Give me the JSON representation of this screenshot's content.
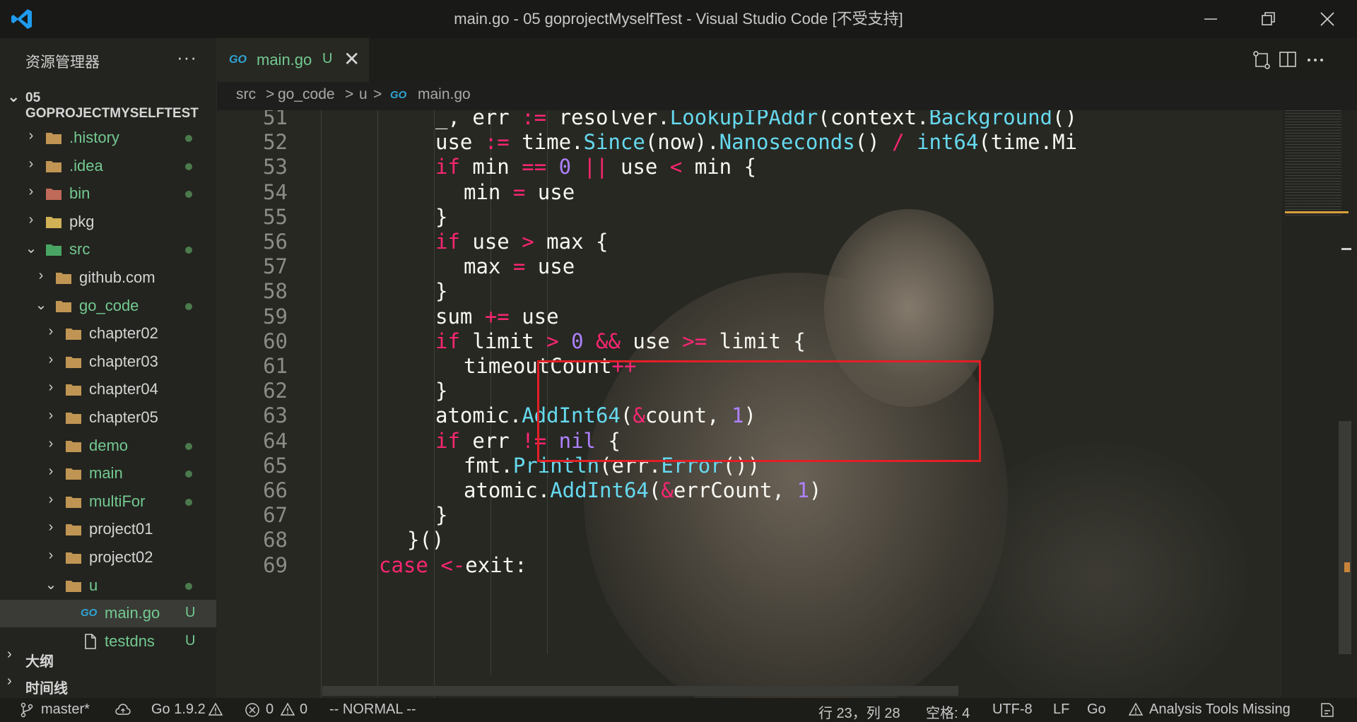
{
  "window": {
    "title": "main.go - 05 goprojectMyselfTest - Visual Studio Code [不受支持]"
  },
  "explorer": {
    "header": "资源管理器",
    "more": "···",
    "project": "05 GOPROJECTMYSELFTEST",
    "items": [
      {
        "name": ".history",
        "depth": 0,
        "expanded": false,
        "status": "dot",
        "color": "green",
        "icon": "folder-icon"
      },
      {
        "name": ".idea",
        "depth": 0,
        "expanded": false,
        "status": "dot",
        "color": "green",
        "icon": "idea-folder-icon"
      },
      {
        "name": "bin",
        "depth": 0,
        "expanded": false,
        "status": "dot",
        "color": "green",
        "icon": "bin-folder-icon"
      },
      {
        "name": "pkg",
        "depth": 0,
        "expanded": false,
        "status": "",
        "color": "plain",
        "icon": "pkg-folder-icon"
      },
      {
        "name": "src",
        "depth": 0,
        "expanded": true,
        "status": "dot",
        "color": "green",
        "icon": "src-folder-icon"
      },
      {
        "name": "github.com",
        "depth": 1,
        "expanded": false,
        "status": "",
        "color": "plain",
        "icon": "folder-icon"
      },
      {
        "name": "go_code",
        "depth": 1,
        "expanded": true,
        "status": "dot",
        "color": "green",
        "icon": "folder-icon"
      },
      {
        "name": "chapter02",
        "depth": 2,
        "expanded": false,
        "status": "",
        "color": "plain",
        "icon": "folder-icon"
      },
      {
        "name": "chapter03",
        "depth": 2,
        "expanded": false,
        "status": "",
        "color": "plain",
        "icon": "folder-icon"
      },
      {
        "name": "chapter04",
        "depth": 2,
        "expanded": false,
        "status": "",
        "color": "plain",
        "icon": "folder-icon"
      },
      {
        "name": "chapter05",
        "depth": 2,
        "expanded": false,
        "status": "",
        "color": "plain",
        "icon": "folder-icon"
      },
      {
        "name": "demo",
        "depth": 2,
        "expanded": false,
        "status": "dot",
        "color": "green",
        "icon": "folder-icon"
      },
      {
        "name": "main",
        "depth": 2,
        "expanded": false,
        "status": "dot",
        "color": "green",
        "icon": "folder-icon"
      },
      {
        "name": "multiFor",
        "depth": 2,
        "expanded": false,
        "status": "dot",
        "color": "green",
        "icon": "folder-icon"
      },
      {
        "name": "project01",
        "depth": 2,
        "expanded": false,
        "status": "",
        "color": "plain",
        "icon": "folder-icon"
      },
      {
        "name": "project02",
        "depth": 2,
        "expanded": false,
        "status": "",
        "color": "plain",
        "icon": "folder-icon"
      },
      {
        "name": "u",
        "depth": 2,
        "expanded": true,
        "status": "dot",
        "color": "green",
        "icon": "folder-icon"
      },
      {
        "name": "main.go",
        "depth": 3,
        "file": true,
        "status": "U",
        "color": "green",
        "icon": "go-file-icon",
        "selected": true
      },
      {
        "name": "testdns",
        "depth": 3,
        "file": true,
        "status": "U",
        "color": "green",
        "icon": "file-icon"
      }
    ],
    "outline": "大纲",
    "timeline": "时间线"
  },
  "tab": {
    "go_label": "GO",
    "name": "main.go",
    "status": "U",
    "close": "✕"
  },
  "breadcrumbs": [
    "src",
    "go_code",
    "u",
    "main.go"
  ],
  "breadcrumb_sep": ">",
  "editor": {
    "lines": [
      {
        "n": "51",
        "indent": 4,
        "tokens": [
          [
            "_, err ",
            ""
          ],
          [
            ":=",
            "op"
          ],
          [
            " resolver.",
            ""
          ],
          [
            "LookupIPAddr",
            "fn"
          ],
          [
            "(context.",
            ""
          ],
          [
            "Background",
            "fn"
          ],
          [
            "()",
            ""
          ]
        ]
      },
      {
        "n": "52",
        "indent": 4,
        "tokens": [
          [
            "use ",
            ""
          ],
          [
            ":=",
            "op"
          ],
          [
            " time.",
            ""
          ],
          [
            "Since",
            "fn"
          ],
          [
            "(now).",
            ""
          ],
          [
            "Nanoseconds",
            "fn"
          ],
          [
            "() ",
            ""
          ],
          [
            "/",
            "op"
          ],
          [
            " ",
            ""
          ],
          [
            "int64",
            "fn"
          ],
          [
            "(time.Mi",
            ""
          ]
        ]
      },
      {
        "n": "53",
        "indent": 4,
        "tokens": [
          [
            "if",
            "kw"
          ],
          [
            " min ",
            ""
          ],
          [
            "==",
            "op"
          ],
          [
            " ",
            ""
          ],
          [
            "0",
            "num"
          ],
          [
            " ",
            ""
          ],
          [
            "||",
            "op"
          ],
          [
            " use ",
            ""
          ],
          [
            "<",
            "op"
          ],
          [
            " min {",
            ""
          ]
        ]
      },
      {
        "n": "54",
        "indent": 5,
        "tokens": [
          [
            "min ",
            ""
          ],
          [
            "=",
            "op"
          ],
          [
            " use",
            ""
          ]
        ]
      },
      {
        "n": "55",
        "indent": 4,
        "tokens": [
          [
            "}",
            ""
          ]
        ]
      },
      {
        "n": "56",
        "indent": 4,
        "tokens": [
          [
            "if",
            "kw"
          ],
          [
            " use ",
            ""
          ],
          [
            ">",
            "op"
          ],
          [
            " max {",
            ""
          ]
        ]
      },
      {
        "n": "57",
        "indent": 5,
        "tokens": [
          [
            "max ",
            ""
          ],
          [
            "=",
            "op"
          ],
          [
            " use",
            ""
          ]
        ]
      },
      {
        "n": "58",
        "indent": 4,
        "tokens": [
          [
            "}",
            ""
          ]
        ]
      },
      {
        "n": "59",
        "indent": 4,
        "tokens": [
          [
            "sum ",
            ""
          ],
          [
            "+=",
            "op"
          ],
          [
            " use",
            ""
          ]
        ]
      },
      {
        "n": "60",
        "indent": 4,
        "tokens": [
          [
            "if",
            "kw"
          ],
          [
            " limit ",
            ""
          ],
          [
            ">",
            "op"
          ],
          [
            " ",
            ""
          ],
          [
            "0",
            "num"
          ],
          [
            " ",
            ""
          ],
          [
            "&&",
            "op"
          ],
          [
            " use ",
            ""
          ],
          [
            ">=",
            "op"
          ],
          [
            " limit {",
            ""
          ]
        ]
      },
      {
        "n": "61",
        "indent": 5,
        "tokens": [
          [
            "timeoutCount",
            ""
          ],
          [
            "++",
            "op"
          ]
        ]
      },
      {
        "n": "62",
        "indent": 4,
        "tokens": [
          [
            "}",
            ""
          ]
        ]
      },
      {
        "n": "63",
        "indent": 4,
        "tokens": [
          [
            "atomic.",
            ""
          ],
          [
            "AddInt64",
            "fn"
          ],
          [
            "(",
            ""
          ],
          [
            "&",
            "op"
          ],
          [
            "count, ",
            ""
          ],
          [
            "1",
            "num"
          ],
          [
            ")",
            ""
          ]
        ]
      },
      {
        "n": "64",
        "indent": 4,
        "tokens": [
          [
            "if",
            "kw"
          ],
          [
            " err ",
            ""
          ],
          [
            "!=",
            "op"
          ],
          [
            " ",
            ""
          ],
          [
            "nil",
            "num"
          ],
          [
            " {",
            ""
          ]
        ]
      },
      {
        "n": "65",
        "indent": 5,
        "tokens": [
          [
            "fmt.",
            ""
          ],
          [
            "Println",
            "fn"
          ],
          [
            "(err.",
            ""
          ],
          [
            "Error",
            "fn"
          ],
          [
            "())",
            ""
          ]
        ]
      },
      {
        "n": "66",
        "indent": 5,
        "tokens": [
          [
            "atomic.",
            ""
          ],
          [
            "AddInt64",
            "fn"
          ],
          [
            "(",
            ""
          ],
          [
            "&",
            "op"
          ],
          [
            "errCount, ",
            ""
          ],
          [
            "1",
            "num"
          ],
          [
            ")",
            ""
          ]
        ]
      },
      {
        "n": "67",
        "indent": 4,
        "tokens": [
          [
            "}",
            ""
          ]
        ]
      },
      {
        "n": "68",
        "indent": 3,
        "tokens": [
          [
            "}()",
            ""
          ]
        ]
      },
      {
        "n": "69",
        "indent": 2,
        "tokens": [
          [
            "case",
            "kw"
          ],
          [
            " ",
            ""
          ],
          [
            "<-",
            "op"
          ],
          [
            "exit:",
            ""
          ]
        ]
      }
    ],
    "highlight_from_line": "59",
    "highlight_to_line": "62"
  },
  "statusbar": {
    "branch": "master*",
    "go_version": "Go 1.9.2",
    "errors": "0",
    "warnings": "0",
    "mode": "-- NORMAL --",
    "position": "行 23，列 28",
    "spaces": "空格: 4",
    "encoding": "UTF-8",
    "eol": "LF",
    "language": "Go",
    "analysis": "Analysis Tools Missing"
  },
  "colors": {
    "editor_bg": "#272822",
    "keyword": "#f92672",
    "function": "#66d9ef",
    "number": "#ae81ff",
    "git_untracked": "#73c991",
    "highlight_box": "#e21f26"
  }
}
